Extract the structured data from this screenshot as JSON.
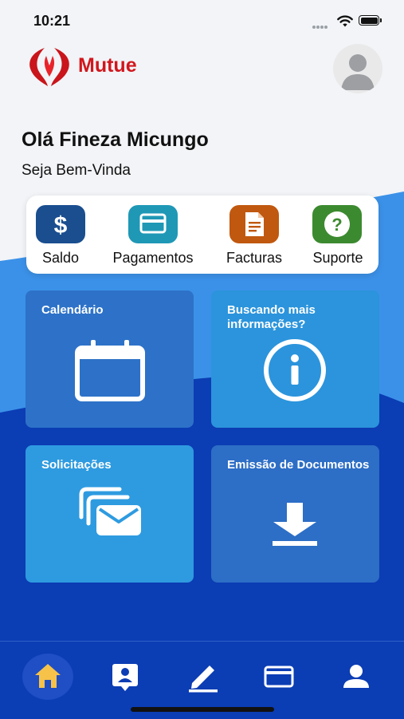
{
  "status_bar": {
    "time": "10:21"
  },
  "header": {
    "brand": "Mutue"
  },
  "greeting": {
    "title": "Olá Fineza Micungo",
    "subtitle": "Seja Bem-Vinda"
  },
  "quick_actions": [
    {
      "label": "Saldo",
      "icon": "dollar-icon",
      "color": "#1a4e8f"
    },
    {
      "label": "Pagamentos",
      "icon": "credit-card-icon",
      "color": "#1f98b6"
    },
    {
      "label": "Facturas",
      "icon": "invoice-icon",
      "color": "#c0580f"
    },
    {
      "label": "Suporte",
      "icon": "help-icon",
      "color": "#3c8a2f"
    }
  ],
  "cards": [
    {
      "title": "Calendário",
      "icon": "calendar-icon",
      "color": "#2d72c8"
    },
    {
      "title": "Buscando mais informações?",
      "icon": "info-icon",
      "color": "#2b94dc"
    },
    {
      "title": "Solicitações",
      "icon": "mail-stack-icon",
      "color": "#2e9be0"
    },
    {
      "title": "Emissão de Documentos",
      "icon": "download-icon",
      "color": "#2d6ec6"
    }
  ],
  "tab_bar": {
    "items": [
      "home-icon",
      "contact-card-icon",
      "edit-icon",
      "credit-card-icon",
      "profile-icon"
    ],
    "active": "home-icon",
    "active_color": "#f6c24a"
  },
  "colors": {
    "brand_red": "#d1171d",
    "wave_light": "#3b91e8",
    "wave_dark": "#0b3db4"
  }
}
